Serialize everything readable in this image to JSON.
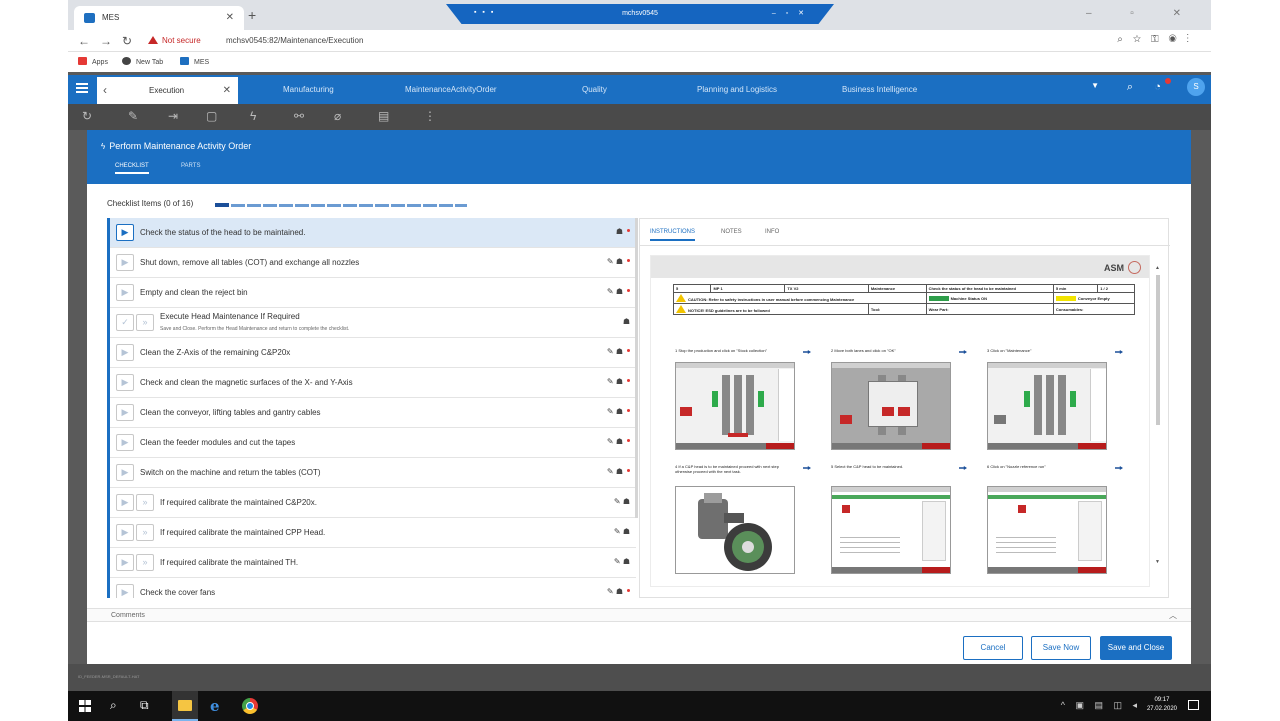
{
  "browser": {
    "tab_title": "MES",
    "remote_title": "mchsv0545",
    "not_secure": "Not secure",
    "url": "mchsv0545:82/Maintenance/Execution",
    "bookmarks": [
      {
        "label": "Apps"
      },
      {
        "label": "New Tab"
      },
      {
        "label": "MES"
      }
    ]
  },
  "app": {
    "execution_tab": "Execution",
    "menu": [
      "Manufacturing",
      "MaintenanceActivityOrder",
      "Quality",
      "Planning and Logistics",
      "Business Intelligence"
    ],
    "user_initial": "S",
    "accent": "#1b6fc2"
  },
  "modal": {
    "title": "Perform Maintenance Activity Order",
    "tabs": [
      "CHECKLIST",
      "PARTS"
    ],
    "checklist_title": "Checklist Items (0 of 16)",
    "progress_fraction": 0,
    "items": [
      {
        "text": "Check the status of the head to be maintained.",
        "active": true
      },
      {
        "text": "Shut down, remove all tables (COT) and exchange all nozzles"
      },
      {
        "text": "Empty and clean the reject bin"
      },
      {
        "text": "Execute Head Maintenance If Required",
        "sub": "Save and Close. Perform the Head Maintenance and return to complete the checklist.",
        "double": true
      },
      {
        "text": "Clean the Z-Axis of the remaining C&P20x"
      },
      {
        "text": "Check and clean the magnetic surfaces of the X- and Y-Axis"
      },
      {
        "text": "Clean the conveyor, lifting tables and gantry cables"
      },
      {
        "text": "Clean the feeder modules and cut the tapes"
      },
      {
        "text": "Switch on the machine and return the tables (COT)"
      },
      {
        "text": "If required calibrate the maintained C&P20x.",
        "double": true
      },
      {
        "text": "If required calibrate the maintained CPP Head.",
        "double": true
      },
      {
        "text": "If required calibrate the maintained TH.",
        "double": true
      },
      {
        "text": "Check the cover fans"
      }
    ],
    "right_tabs": [
      "INSTRUCTIONS",
      "NOTES",
      "INFO"
    ],
    "doc": {
      "brand": "ASM",
      "row1": [
        "5",
        "MP 1",
        "TX V2",
        "Maintenance",
        "Check the status of the head to be maintained",
        "5 min",
        "1 / 2"
      ],
      "caution": "CAUTION: Refer to safety instructions in user manual before commencing Maintenance",
      "machine_status": "Machine Status ON",
      "conveyor": "Conveyor Empty",
      "notice": "NOTICE! ESD guidelines are to be followed",
      "tool": "Tool:",
      "wear_part": "Wear Part:",
      "consumables": "Consumables:",
      "steps": [
        "1  Stop the production and click on \"Stock collection\"",
        "2  Move both lanes and click on \"OK\"",
        "3  Click on \"Maintenance\"",
        "4  If a C&P head is to be maintained proceed with next step otherwise proceed with the next task.",
        "5  Select the C&P head to be maintained.",
        "6  Click on \"Nozzle reference run\""
      ]
    },
    "comments_label": "Comments",
    "buttons": {
      "cancel": "Cancel",
      "save_now": "Save Now",
      "save_close": "Save and Close"
    }
  },
  "background": {
    "status_text": "ID_FEEDER-MSR_DEFAULT-HAT"
  },
  "taskbar": {
    "time": "09:17",
    "date": "27.02.2020"
  }
}
